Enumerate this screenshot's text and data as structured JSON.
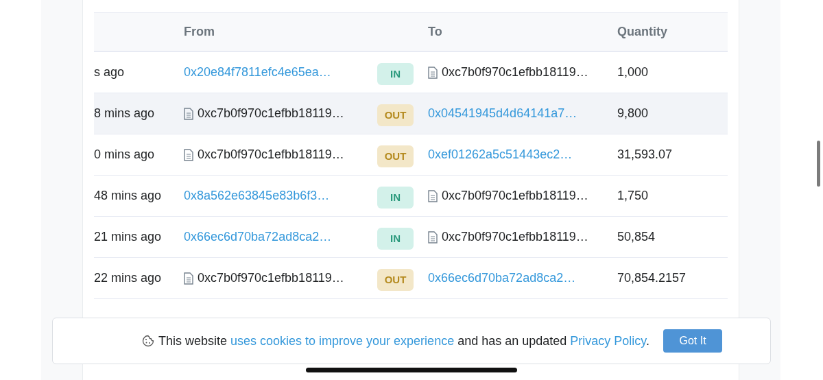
{
  "table": {
    "columns": [
      "From",
      "To",
      "Quantity"
    ],
    "rows": [
      {
        "age": "s ago",
        "from": {
          "kind": "link",
          "text": "0x20e84f7811efc4e65ea…"
        },
        "badge": {
          "kind": "in",
          "label": "IN"
        },
        "to": {
          "kind": "contract",
          "text": "0xc7b0f970c1efbb18119…"
        },
        "quantity": "1,000",
        "hovered": false
      },
      {
        "age": "8 mins ago",
        "from": {
          "kind": "contract",
          "text": "0xc7b0f970c1efbb18119…"
        },
        "badge": {
          "kind": "out",
          "label": "OUT"
        },
        "to": {
          "kind": "link",
          "text": "0x04541945d4d64141a7…"
        },
        "quantity": "9,800",
        "hovered": true
      },
      {
        "age": "0 mins ago",
        "from": {
          "kind": "contract",
          "text": "0xc7b0f970c1efbb18119…"
        },
        "badge": {
          "kind": "out",
          "label": "OUT"
        },
        "to": {
          "kind": "link",
          "text": "0xef01262a5c51443ec2…"
        },
        "quantity": "31,593.07",
        "hovered": false
      },
      {
        "age": "48 mins ago",
        "from": {
          "kind": "link",
          "text": "0x8a562e63845e83b6f3…"
        },
        "badge": {
          "kind": "in",
          "label": "IN"
        },
        "to": {
          "kind": "contract",
          "text": "0xc7b0f970c1efbb18119…"
        },
        "quantity": "1,750",
        "hovered": false
      },
      {
        "age": "21 mins ago",
        "from": {
          "kind": "link",
          "text": "0x66ec6d70ba72ad8ca2…"
        },
        "badge": {
          "kind": "in",
          "label": "IN"
        },
        "to": {
          "kind": "contract",
          "text": "0xc7b0f970c1efbb18119…"
        },
        "quantity": "50,854",
        "hovered": false
      },
      {
        "age": "22 mins ago",
        "from": {
          "kind": "contract",
          "text": "0xc7b0f970c1efbb18119…"
        },
        "badge": {
          "kind": "out",
          "label": "OUT"
        },
        "to": {
          "kind": "link",
          "text": "0x66ec6d70ba72ad8ca2…"
        },
        "quantity": "70,854.2157",
        "hovered": false
      }
    ]
  },
  "cookie_banner": {
    "text_before": "This website",
    "link": "uses cookies to improve your experience",
    "text_middle": "and has an updated",
    "policy_link": "Privacy Policy",
    "text_after": ".",
    "button": "Got It"
  }
}
